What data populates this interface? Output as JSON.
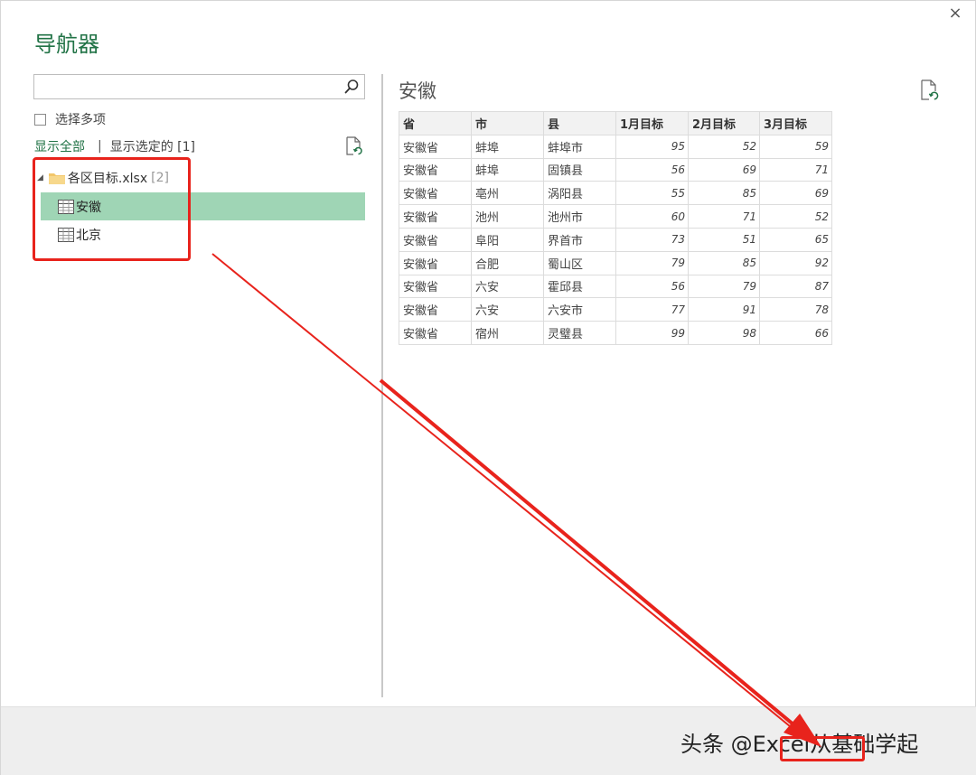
{
  "window": {
    "title": "导航器",
    "close_glyph": "×"
  },
  "left_pane": {
    "search": {
      "value": "",
      "placeholder": ""
    },
    "multi_select_label": "选择多项",
    "show_all_label": "显示全部",
    "separator": "|",
    "show_selected_label": "显示选定的 [1]",
    "tree": {
      "folder": {
        "name": "各区目标.xlsx",
        "count": "[2]"
      },
      "items": [
        {
          "label": "安徽",
          "selected": true
        },
        {
          "label": "北京",
          "selected": false
        }
      ]
    }
  },
  "preview": {
    "title": "安徽",
    "columns": [
      "省",
      "市",
      "县",
      "1月目标",
      "2月目标",
      "3月目标"
    ],
    "rows": [
      [
        "安徽省",
        "蚌埠",
        "蚌埠市",
        "95",
        "52",
        "59"
      ],
      [
        "安徽省",
        "蚌埠",
        "固镇县",
        "56",
        "69",
        "71"
      ],
      [
        "安徽省",
        "亳州",
        "涡阳县",
        "55",
        "85",
        "69"
      ],
      [
        "安徽省",
        "池州",
        "池州市",
        "60",
        "71",
        "52"
      ],
      [
        "安徽省",
        "阜阳",
        "界首市",
        "73",
        "51",
        "65"
      ],
      [
        "安徽省",
        "合肥",
        "蜀山区",
        "79",
        "85",
        "92"
      ],
      [
        "安徽省",
        "六安",
        "霍邱县",
        "56",
        "79",
        "87"
      ],
      [
        "安徽省",
        "六安",
        "六安市",
        "77",
        "91",
        "78"
      ],
      [
        "安徽省",
        "宿州",
        "灵璧县",
        "99",
        "98",
        "66"
      ]
    ]
  },
  "footer": {
    "watermark": "头条 @Excel从基础学起"
  },
  "colors": {
    "accent_green": "#217346",
    "selected_row": "#9fd5b5",
    "annotation_red": "#e8231c"
  },
  "icons": {
    "search": "search-icon",
    "refresh": "refresh-icon",
    "folder": "folder-icon",
    "table": "table-icon",
    "close": "close-icon",
    "expand": "triangle-expanded-icon"
  }
}
